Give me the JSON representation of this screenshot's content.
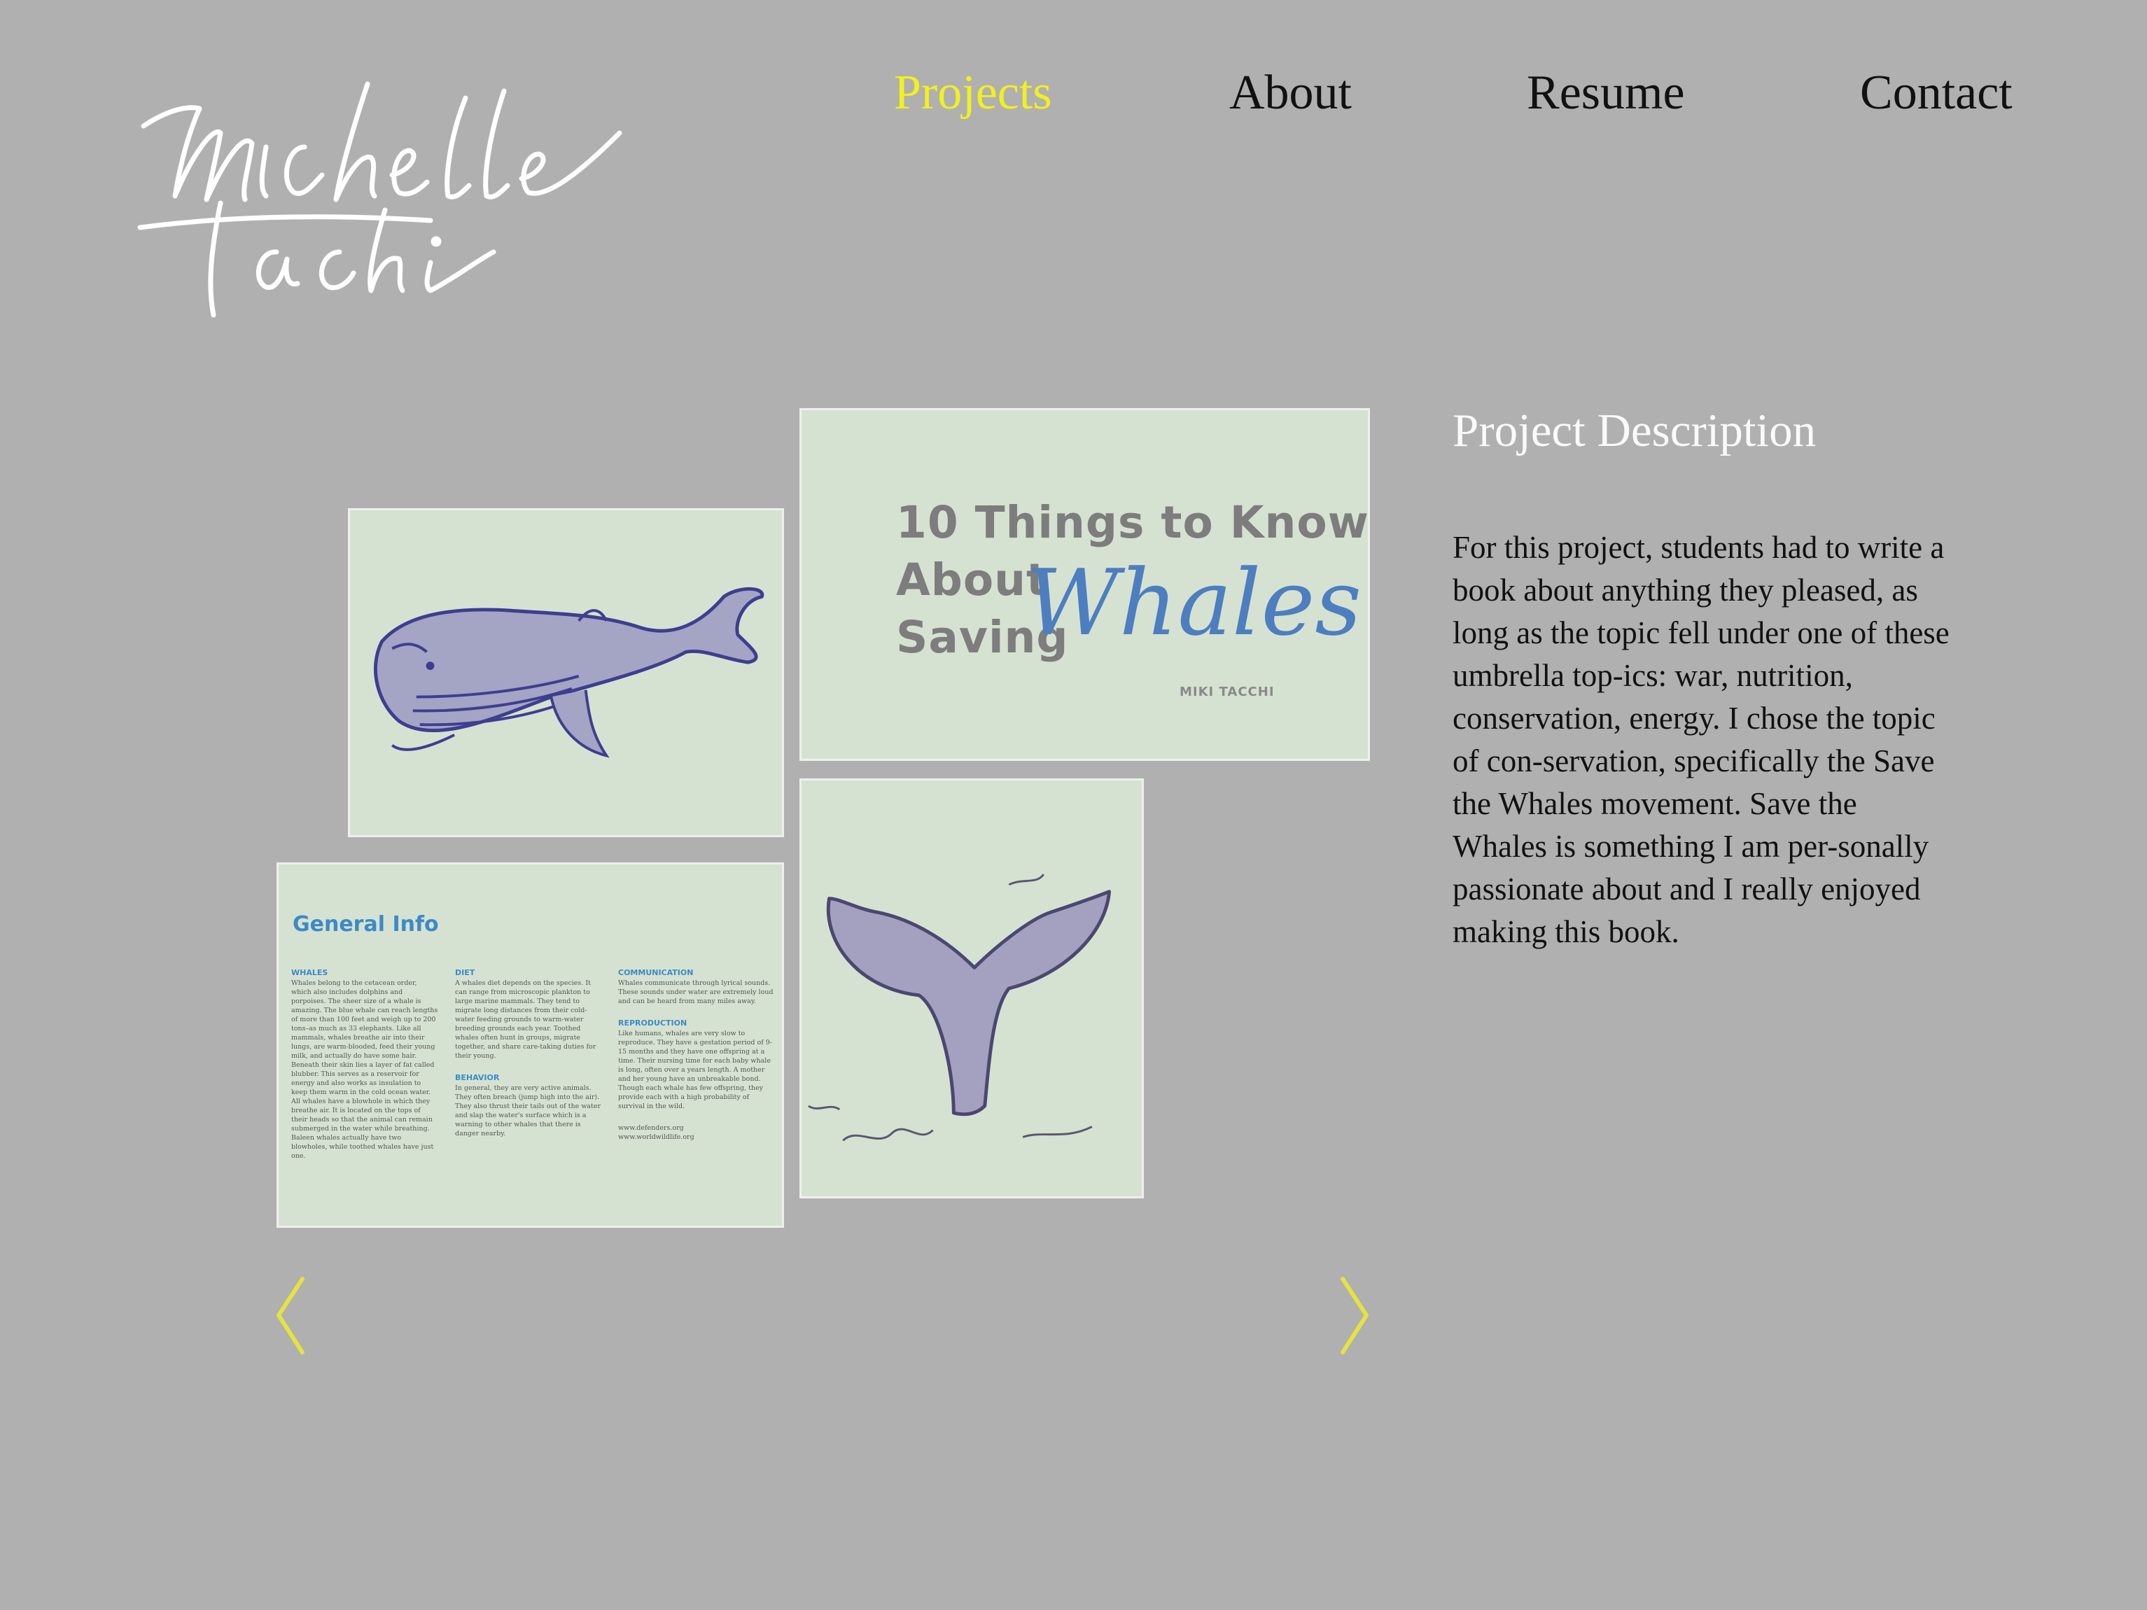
{
  "brand": {
    "name": "Michelle Tacchi"
  },
  "nav": {
    "items": [
      {
        "label": "Projects",
        "active": true
      },
      {
        "label": "About",
        "active": false
      },
      {
        "label": "Resume",
        "active": false
      },
      {
        "label": "Contact",
        "active": false
      }
    ],
    "active_color": "#f1f020"
  },
  "gallery": {
    "cover": {
      "title": "10 Things to Know\nAbout\nSaving",
      "script_word": "Whales",
      "author": "MIKI TACCHI"
    },
    "info_page": {
      "title": "General Info",
      "sections": [
        {
          "heading": "WHALES",
          "text": "Whales belong to the cetacean order, which also includes dolphins and porpoises. The sheer size of a whale is amazing. The blue whale can reach lengths of more than 100 feet and weigh up to 200 tons–as much as 33 elephants. Like all mammals, whales breathe air into their lungs, are warm-blooded, feed their young milk, and actually do have some hair. Beneath their skin lies a layer of fat called blubber. This serves as a reservoir for energy and also works as insulation to keep them warm in the cold ocean water. All whales have a blowhole in which they breathe air. It is located on the tops of their heads so that the animal can remain submerged in the water while breathing. Baleen whales actually have two blowholes, while toothed whales have just one."
        },
        {
          "heading": "DIET",
          "text": "A whales diet depends on the species. It can range from microscopic plankton to large marine mammals. They tend to migrate long distances from their cold-water feeding grounds to warm-water breeding grounds each year. Toothed whales often hunt in groups, migrate together, and share care-taking duties for their young."
        },
        {
          "heading": "BEHAVIOR",
          "text": "In general, they are very active animals. They often breach (jump high into the air). They also thrust their tails out of the water and slap the water's surface which is a warning to other whales that there is danger nearby."
        },
        {
          "heading": "COMMUNICATION",
          "text": "Whales communicate through lyrical sounds. These sounds under water are extremely loud and can be heard from many miles away."
        },
        {
          "heading": "REPRODUCTION",
          "text": "Like humans, whales are very slow to reproduce. They have a gestation period of 9-15 months and they have one offspring at a time. Their nursing time for each baby whale is long, often over a years length. A mother and her young have an unbreakable bond. Though each whale has few offspring, they provide each with a high probability of survival in the wild."
        }
      ],
      "links": [
        "www.defenders.org",
        "www.worldwildlife.org"
      ]
    },
    "prev_icon": "chevron-left-icon",
    "next_icon": "chevron-right-icon",
    "arrow_color": "#e4e340"
  },
  "description": {
    "title": "Project Description",
    "body": "For this project, students had to write a book about anything they pleased, as long as the topic fell under one of these umbrella top-ics: war, nutrition, conservation, energy. I chose the topic of con-servation, specifically the Save the Whales movement. Save the Whales is something I am per-sonally passionate about and I really enjoyed making this book."
  }
}
